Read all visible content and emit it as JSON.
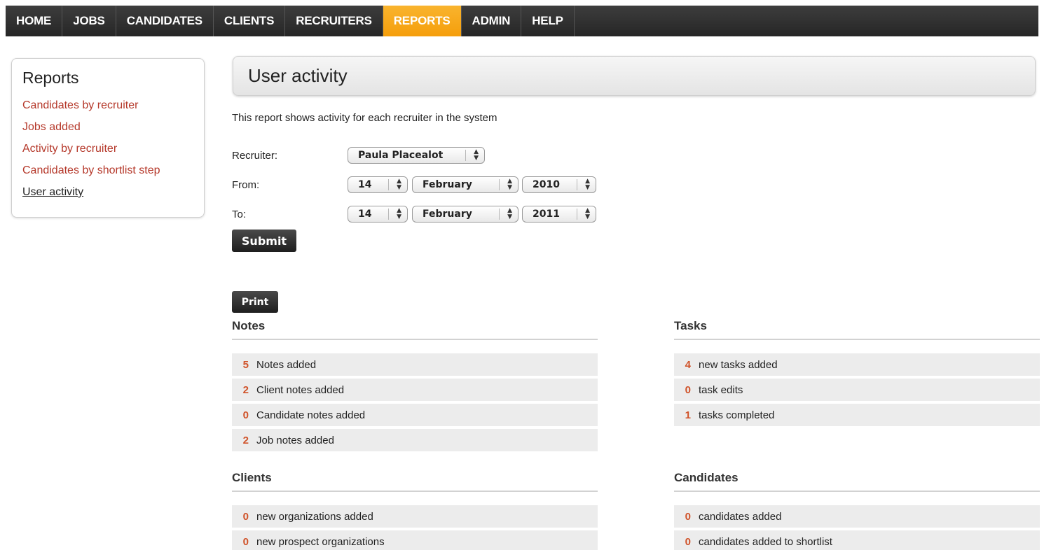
{
  "nav": {
    "items": [
      {
        "label": "HOME"
      },
      {
        "label": "JOBS"
      },
      {
        "label": "CANDIDATES"
      },
      {
        "label": "CLIENTS"
      },
      {
        "label": "RECRUITERS"
      },
      {
        "label": "REPORTS"
      },
      {
        "label": "ADMIN"
      },
      {
        "label": "HELP"
      }
    ],
    "active": "REPORTS"
  },
  "sidebar": {
    "title": "Reports",
    "links": [
      {
        "label": "Candidates by recruiter"
      },
      {
        "label": "Jobs added"
      },
      {
        "label": "Activity by recruiter"
      },
      {
        "label": "Candidates by shortlist step"
      },
      {
        "label": "User activity"
      }
    ],
    "current": "User activity"
  },
  "page": {
    "title": "User activity",
    "description": "This report shows activity for each recruiter in the system"
  },
  "form": {
    "recruiter_label": "Recruiter:",
    "recruiter_value": "Paula Placealot",
    "from_label": "From:",
    "from_day": "14",
    "from_month": "February",
    "from_year": "2010",
    "to_label": "To:",
    "to_day": "14",
    "to_month": "February",
    "to_year": "2011",
    "submit_label": "Submit"
  },
  "print_label": "Print",
  "sections": {
    "notes": {
      "title": "Notes",
      "rows": [
        {
          "count": "5",
          "label": "Notes added"
        },
        {
          "count": "2",
          "label": "Client notes added"
        },
        {
          "count": "0",
          "label": "Candidate notes added"
        },
        {
          "count": "2",
          "label": "Job notes added"
        }
      ]
    },
    "tasks": {
      "title": "Tasks",
      "rows": [
        {
          "count": "4",
          "label": "new tasks added"
        },
        {
          "count": "0",
          "label": "task edits"
        },
        {
          "count": "1",
          "label": "tasks completed"
        }
      ]
    },
    "clients": {
      "title": "Clients",
      "rows": [
        {
          "count": "0",
          "label": "new organizations added"
        },
        {
          "count": "0",
          "label": "new prospect organizations"
        }
      ]
    },
    "candidates": {
      "title": "Candidates",
      "rows": [
        {
          "count": "0",
          "label": "candidates added"
        },
        {
          "count": "0",
          "label": "candidates added to shortlist"
        }
      ]
    }
  },
  "colors": {
    "accent": "#f5a51b",
    "link": "#b5382a",
    "count": "#d0532a",
    "nav_bg": "#2e2e2e"
  }
}
